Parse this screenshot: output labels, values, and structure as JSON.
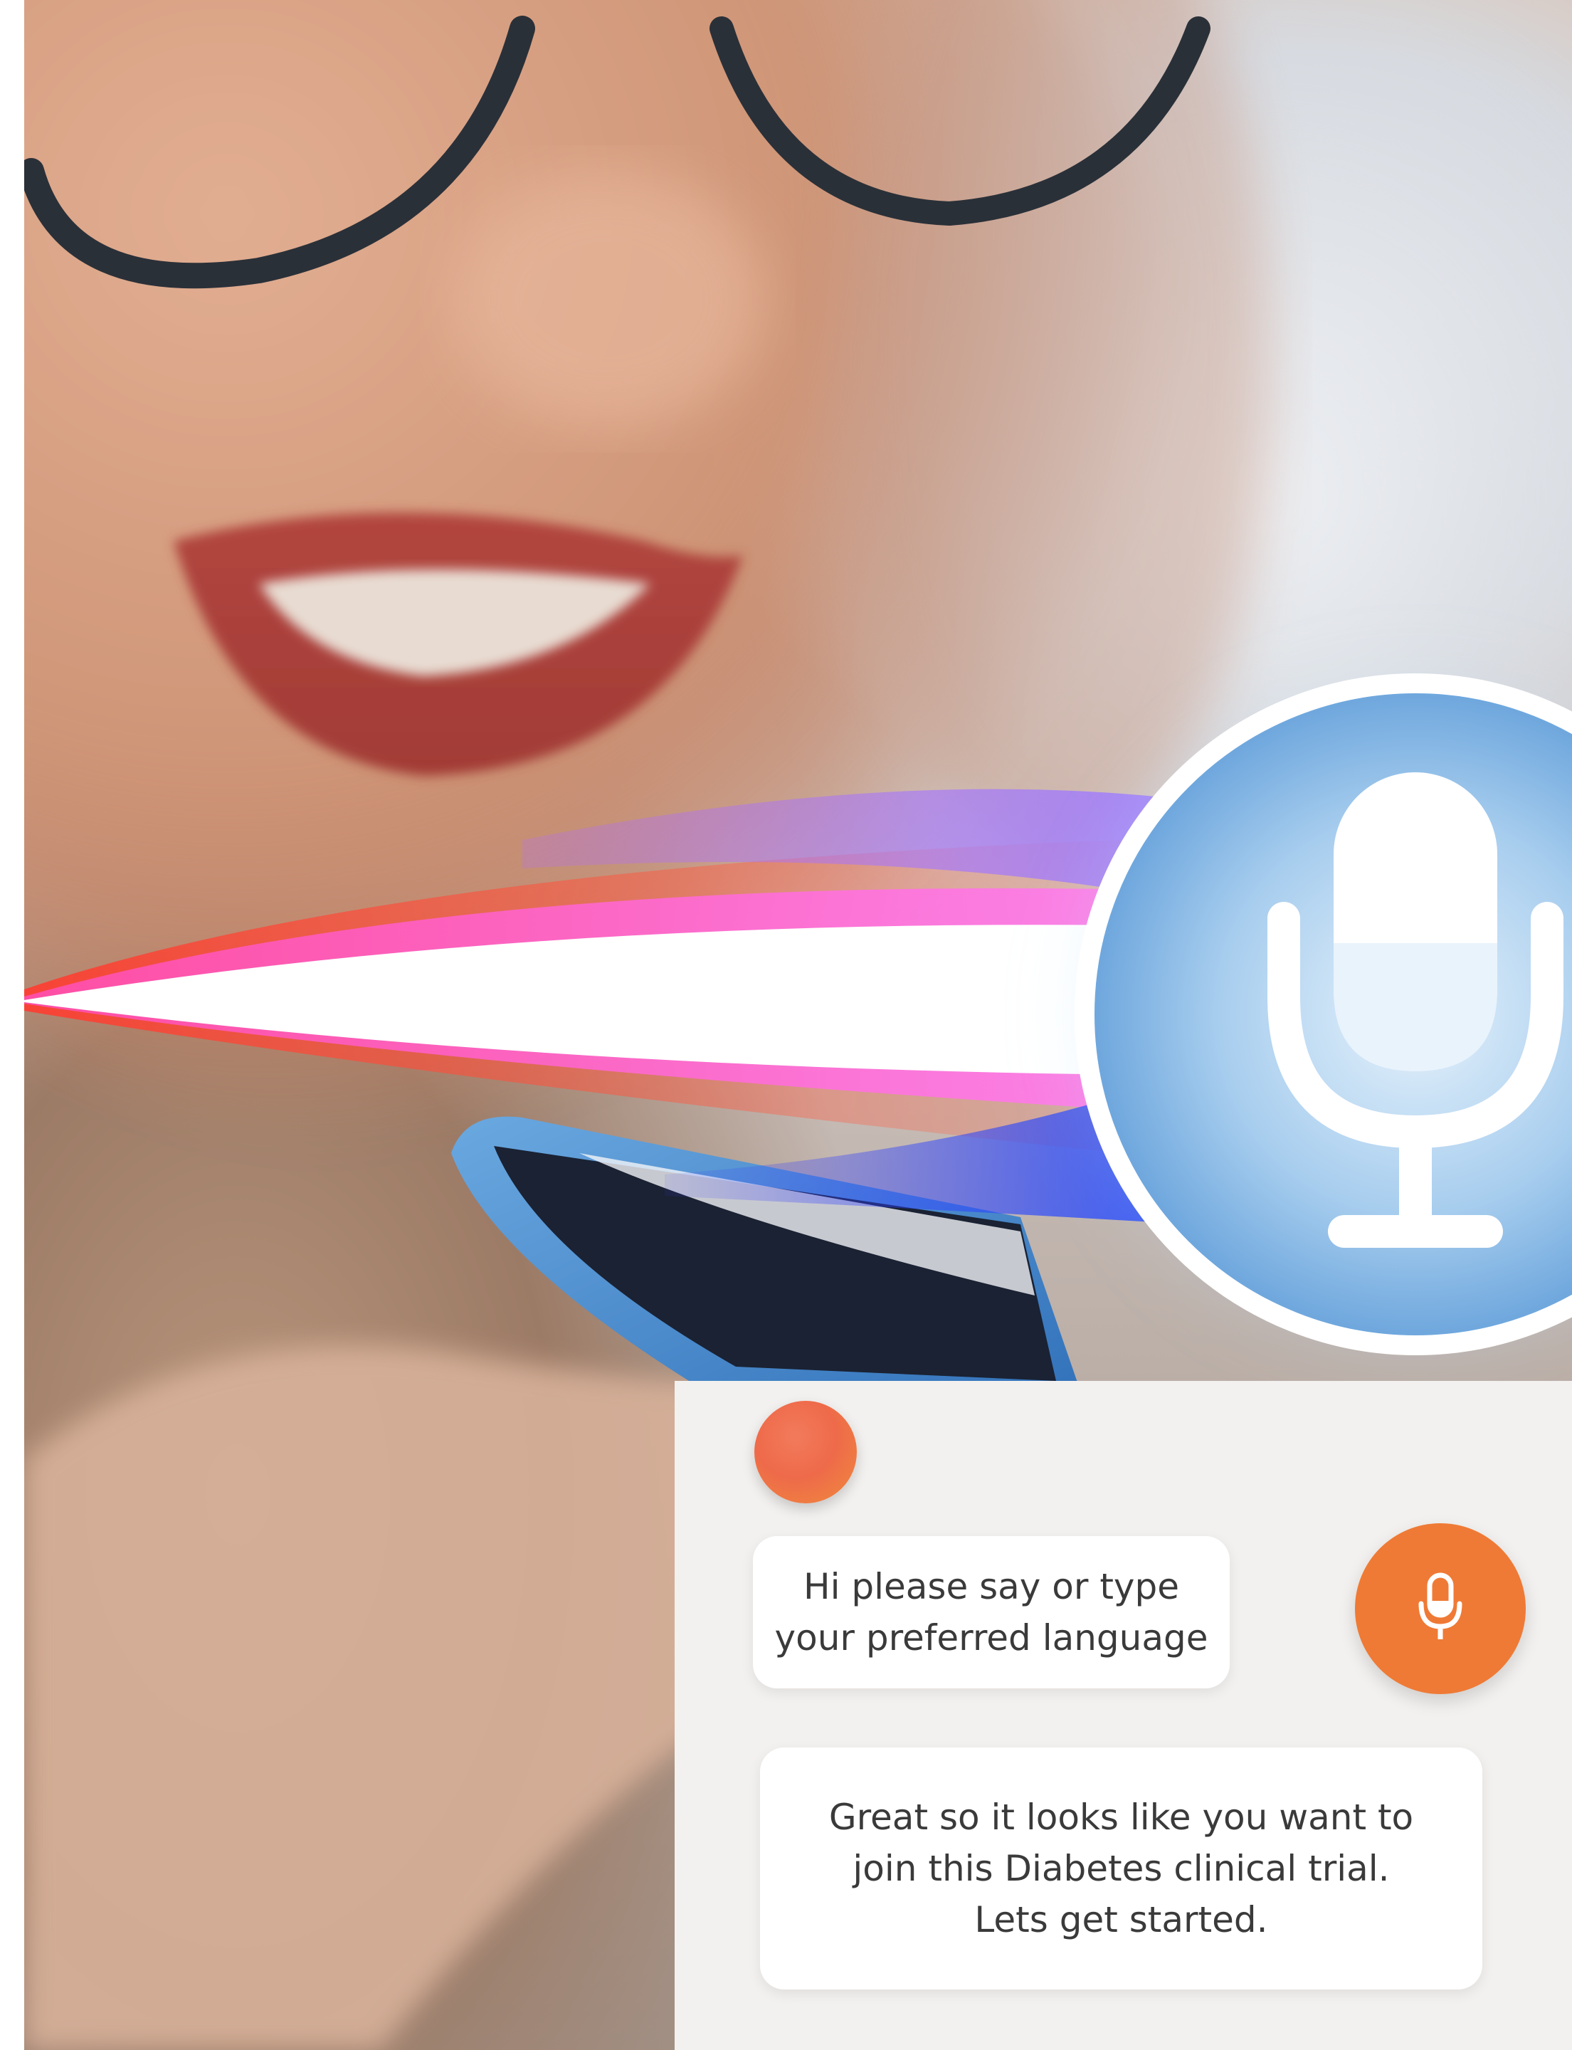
{
  "chat": {
    "greeting_message": "Hi please say or type\nyour preferred language",
    "confirmation_message": "Great so it looks like you want to\njoin this Diabetes clinical trial.\nLets get started."
  },
  "icons": {
    "hero": "microphone-icon",
    "assistant": "bot-avatar-icon",
    "voice_button": "microphone-icon"
  },
  "colors": {
    "accent_orange": "#ef7a35",
    "avatar_orange": "#ee6a4a",
    "panel_background": "#f3f1ef",
    "bubble_background": "#ffffff",
    "text": "#3a3a3a",
    "wave_red": "#ff3b2f",
    "wave_magenta": "#ff4fe0",
    "wave_violet": "#a86bff",
    "wave_blue": "#2b5bff"
  }
}
